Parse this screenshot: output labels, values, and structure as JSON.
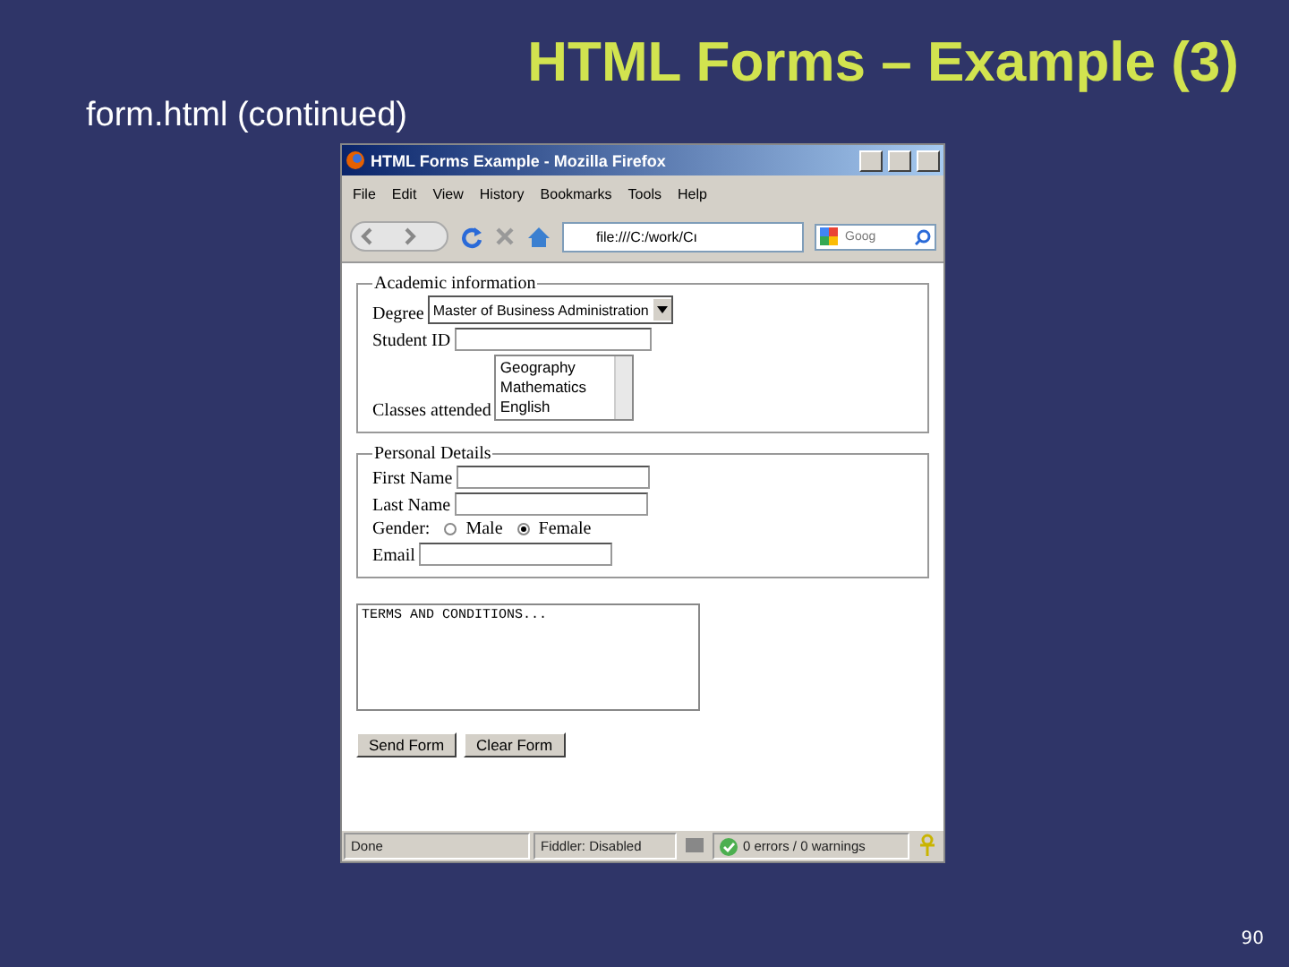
{
  "slide": {
    "title": "HTML Forms – Example (3)",
    "subtitle": "form.html (continued)",
    "page_number": "90"
  },
  "browser": {
    "title": "HTML Forms Example - Mozilla Firefox",
    "menu": [
      "File",
      "Edit",
      "View",
      "History",
      "Bookmarks",
      "Tools",
      "Help"
    ],
    "address": "file:///C:/work/Cı",
    "search_placeholder": "Goog"
  },
  "academic": {
    "legend": "Academic information",
    "degree_label": "Degree",
    "degree_value": "Master of Business Administration",
    "student_id_label": "Student ID",
    "classes_label": "Classes attended",
    "classes": [
      {
        "label": "Geography",
        "selected": false
      },
      {
        "label": "Mathematics",
        "selected": false
      },
      {
        "label": "English",
        "selected": false
      }
    ]
  },
  "personal": {
    "legend": "Personal Details",
    "first_name_label": "First Name",
    "last_name_label": "Last Name",
    "gender_label": "Gender:",
    "genders": [
      {
        "label": "Male",
        "selected": false
      },
      {
        "label": "Female",
        "selected": true
      }
    ],
    "email_label": "Email"
  },
  "terms": "TERMS AND CONDITIONS...",
  "buttons": [
    "Send Form",
    "Clear Form"
  ],
  "status_bar": {
    "status": "Done",
    "fiddler": "Fiddler: Disabled",
    "validator": "0 errors / 0 warnings"
  }
}
